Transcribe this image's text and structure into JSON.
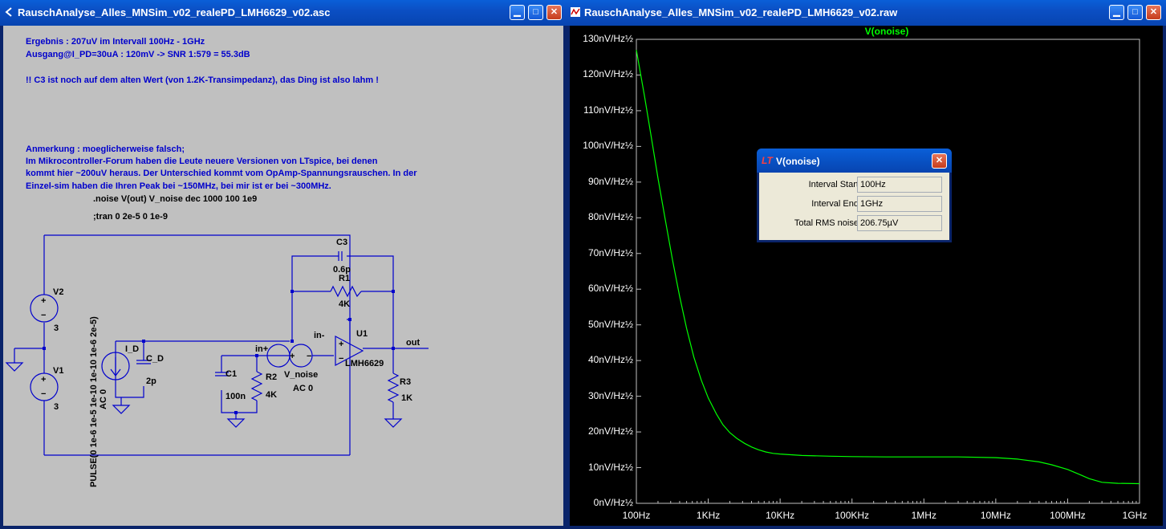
{
  "schematic_window": {
    "title": "RauschAnalyse_Alles_MNSim_v02_realePD_LMH6629_v02.asc",
    "notes": [
      "Ergebnis : 207uV im Intervall 100Hz - 1GHz",
      "Ausgang@I_PD=30uA : 120mV -> SNR 1:579 = 55.3dB",
      "!! C3 ist noch auf dem alten Wert (von 1.2K-Transimpedanz), das Ding ist also lahm !",
      "Anmerkung : moeglicherweise falsch;",
      "Im Mikrocontroller-Forum haben die Leute neuere Versionen von LTspice, bei denen",
      "kommt hier ~200uV heraus. Der Unterschied kommt vom OpAmp-Spannungsrauschen. In der",
      "Einzel-sim haben die Ihren Peak bei ~150MHz, bei mir ist er bei ~300MHz."
    ],
    "directives": {
      "noise": ".noise V(out) V_noise dec 1000 100 1e9",
      "tran": ";tran 0 2e-5 0 1e-9"
    },
    "components": {
      "v2_name": "V2",
      "v2_value": "3",
      "v1_name": "V1",
      "v1_value": "3",
      "pulse": "PULSE(0 1e-6 1e-5 1e-10 1e-10 1e-6 2e-5)",
      "ac0_id": "AC 0",
      "i_d": "I_D",
      "c_d": "C_D",
      "c_d_value": "2p",
      "c1": "C1",
      "c1_value": "100n",
      "r2": "R2",
      "r2_value": "4K",
      "net_inplus": "in+",
      "net_inminus": "in-",
      "v_noise": "V_noise",
      "v_noise_value": "AC 0",
      "c3": "C3",
      "c3_value": "0.6p",
      "r1": "R1",
      "r1_value": "4K",
      "u1": "U1",
      "u1_value": "LMH6629",
      "r3": "R3",
      "r3_value": "1K",
      "net_out": "out"
    }
  },
  "waveform_window": {
    "title": "RauschAnalyse_Alles_MNSim_v02_realePD_LMH6629_v02.raw",
    "trace_label": "V(onoise)",
    "trace_color": "#00ff00"
  },
  "chart_data": {
    "type": "line",
    "title": "V(onoise)",
    "x_scale": "log",
    "xlim": [
      100,
      1000000000
    ],
    "ylim": [
      0,
      130
    ],
    "x_ticks": [
      "100Hz",
      "1KHz",
      "10KHz",
      "100KHz",
      "1MHz",
      "10MHz",
      "100MHz",
      "1GHz"
    ],
    "y_ticks": [
      "0nV/Hz½",
      "10nV/Hz½",
      "20nV/Hz½",
      "30nV/Hz½",
      "40nV/Hz½",
      "50nV/Hz½",
      "60nV/Hz½",
      "70nV/Hz½",
      "80nV/Hz½",
      "90nV/Hz½",
      "100nV/Hz½",
      "110nV/Hz½",
      "120nV/Hz½",
      "130nV/Hz½"
    ],
    "y_unit": "nV/Hz½",
    "series": [
      {
        "name": "V(onoise)",
        "color": "#00ff00",
        "x": [
          100,
          130,
          160,
          200,
          250,
          320,
          400,
          500,
          630,
          800,
          1000,
          1300,
          1600,
          2000,
          2500,
          3200,
          4000,
          5000,
          6300,
          8000,
          10000,
          20000,
          50000,
          100000,
          300000,
          1000000,
          3000000,
          10000000,
          20000000,
          40000000,
          60000000,
          100000000,
          150000000,
          200000000,
          300000000,
          500000000,
          1000000000
        ],
        "y": [
          127,
          114,
          103,
          91,
          80,
          68,
          58,
          49,
          41,
          34.5,
          29.5,
          25,
          22,
          19.8,
          18.2,
          16.8,
          15.8,
          15.0,
          14.4,
          14.0,
          13.8,
          13.4,
          13.2,
          13.1,
          13.0,
          13.0,
          13.0,
          12.8,
          12.4,
          11.6,
          10.8,
          9.5,
          8.0,
          6.9,
          5.9,
          5.6,
          5.5
        ]
      }
    ]
  },
  "dialog": {
    "title": "V(onoise)",
    "rows": [
      {
        "label": "Interval Start:",
        "value": "100Hz"
      },
      {
        "label": "Interval End:",
        "value": "1GHz"
      },
      {
        "label": "Total RMS noise:",
        "value": "206.75µV"
      }
    ]
  }
}
